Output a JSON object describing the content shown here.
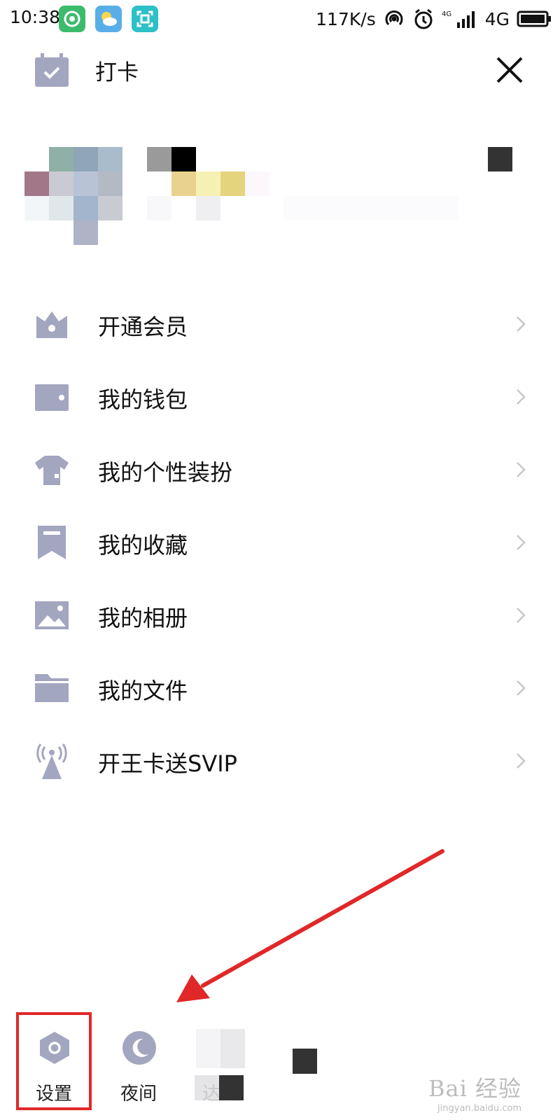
{
  "status_bar": {
    "time": "10:38",
    "network_speed": "117K/s",
    "network_type": "4G"
  },
  "header": {
    "checkin_label": "打卡"
  },
  "menu": {
    "items": [
      {
        "label": "开通会员",
        "icon": "crown-icon"
      },
      {
        "label": "我的钱包",
        "icon": "wallet-icon"
      },
      {
        "label": "我的个性装扮",
        "icon": "tshirt-icon"
      },
      {
        "label": "我的收藏",
        "icon": "bookmark-icon"
      },
      {
        "label": "我的相册",
        "icon": "photo-icon"
      },
      {
        "label": "我的文件",
        "icon": "folder-icon"
      },
      {
        "label": "开王卡送SVIP",
        "icon": "signal-tower-icon"
      }
    ]
  },
  "bottom_bar": {
    "settings_label": "设置",
    "night_label": "夜间",
    "talent_label": "达人"
  },
  "watermark": {
    "brand": "Bai 经验",
    "url": "jingyan.baidu.com"
  },
  "colors": {
    "icon_gray": "#a3a6bf",
    "highlight_red": "#e02828",
    "arrow_red": "#e02828"
  }
}
